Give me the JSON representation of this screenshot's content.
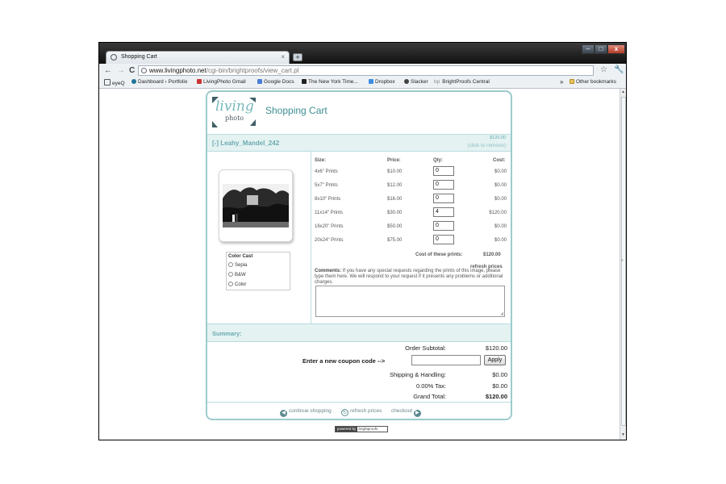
{
  "browser": {
    "tab_title": "Shopping Cart",
    "tab_close": "×",
    "new_tab": "+",
    "url_domain": "www.livingphoto.net",
    "url_path": "/cgi-bin/brightproofs/view_cart.pl",
    "back": "←",
    "forward": "→",
    "reload": "C",
    "star": "☆",
    "wrench": "🔧",
    "min": "–",
    "max": "□",
    "close": "x",
    "bookmarks": [
      {
        "label": "eyeQ",
        "color": "#ffffff"
      },
      {
        "label": "Dashboard ‹ Portfolio",
        "color": "#21759b"
      },
      {
        "label": "LivingPhoto Gmail",
        "color": "#c33"
      },
      {
        "label": "Google Docs",
        "color": "#4a7ed8"
      },
      {
        "label": "The New York Time...",
        "color": "#222"
      },
      {
        "label": "Dropbox",
        "color": "#3d8de0"
      },
      {
        "label": "Slacker",
        "color": "#444"
      },
      {
        "label": "BrightProofs Central",
        "color": "#888"
      }
    ],
    "bp_prefix": "bp",
    "chevron": "»",
    "other_bookmarks": "Other bookmarks"
  },
  "page": {
    "logo_line1": "living",
    "logo_line2": "photo",
    "title": "Shopping Cart",
    "item_name": "[-] Leahy_Mandel_242",
    "item_amount": "$120.00",
    "item_remove": "(click to remove)",
    "color_cast": {
      "heading": "Color Cast",
      "options": [
        "Sepia",
        "B&W",
        "Color"
      ]
    },
    "table": {
      "headers": {
        "size": "Size:",
        "price": "Price:",
        "qty": "Qty:",
        "cost": "Cost:"
      },
      "rows": [
        {
          "size": "4x6\" Prints",
          "price": "$10.00",
          "qty": "0",
          "cost": "$0.00"
        },
        {
          "size": "5x7\" Prints",
          "price": "$12.00",
          "qty": "0",
          "cost": "$0.00"
        },
        {
          "size": "8x10\" Prints",
          "price": "$16.00",
          "qty": "0",
          "cost": "$0.00"
        },
        {
          "size": "11x14\" Prints",
          "price": "$30.00",
          "qty": "4",
          "cost": "$120.00"
        },
        {
          "size": "16x20\" Prints",
          "price": "$50.00",
          "qty": "0",
          "cost": "$0.00"
        },
        {
          "size": "20x24\" Prints",
          "price": "$75.00",
          "qty": "0",
          "cost": "$0.00"
        }
      ],
      "cost_label": "Cost of these prints:",
      "cost_value": "$120.00",
      "refresh": "refresh prices"
    },
    "comments_label": "Comments:",
    "comments_text": "If you have any special requests regarding the prints of this image, please type them here. We will respond to your request if it presents any problems or additional charges.",
    "summary": {
      "heading": "Summary:",
      "order_subtotal_label": "Order Subtotal:",
      "order_subtotal": "$120.00",
      "coupon_label": "Enter a new coupon code -->",
      "apply": "Apply",
      "shipping_label": "Shipping & Handling:",
      "shipping": "$0.00",
      "tax_label": "0.00% Tax:",
      "tax": "$0.00",
      "grand_label": "Grand Total:",
      "grand": "$120.00"
    },
    "footer": {
      "continue": "continue shopping",
      "refresh": "refresh prices",
      "checkout": "checkout"
    },
    "powered_by": "powered by",
    "powered_brand": "brightproofs"
  }
}
